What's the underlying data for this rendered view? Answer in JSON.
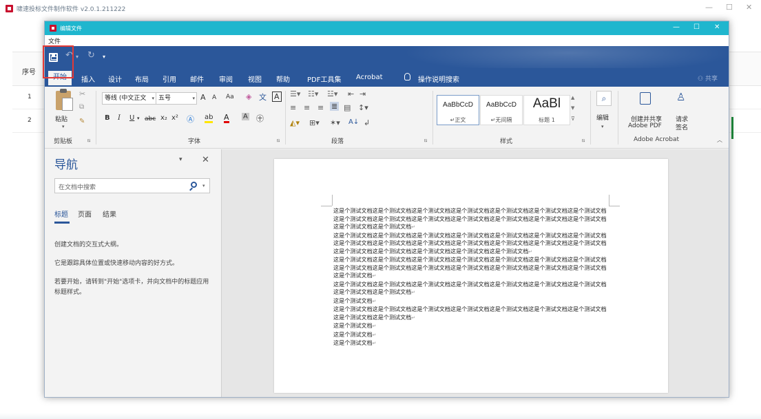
{
  "outer_app": {
    "title": "啸速投标文件制作软件 v2.0.1.211222",
    "table_header": "序号",
    "rows": [
      "1",
      "2"
    ]
  },
  "editor": {
    "title": "编辑文件",
    "menu_file": "文件"
  },
  "word": {
    "tabs": [
      "开始",
      "插入",
      "设计",
      "布局",
      "引用",
      "邮件",
      "审阅",
      "视图",
      "帮助",
      "PDF工具集",
      "Acrobat"
    ],
    "tell_me": "操作说明搜索",
    "share": "共享",
    "ribbon": {
      "clipboard": {
        "paste": "粘贴",
        "label": "剪贴板"
      },
      "font": {
        "name": "等线 (中文正文",
        "size": "五号",
        "label": "字体",
        "grow": "A",
        "shrink": "A",
        "case": "Aa"
      },
      "paragraph": {
        "label": "段落"
      },
      "styles": {
        "label": "样式",
        "items": [
          {
            "sample": "AaBbCcD",
            "name": "正文"
          },
          {
            "sample": "AaBbCcD",
            "name": "无间隔"
          },
          {
            "sample": "AaBl",
            "name": "标题 1"
          }
        ]
      },
      "editing": {
        "label": "编辑"
      },
      "acrobat": {
        "create": "创建并共享",
        "create2": "Adobe PDF",
        "request": "请求",
        "request2": "签名",
        "label": "Adobe Acrobat"
      }
    }
  },
  "nav": {
    "title": "导航",
    "search_placeholder": "在文档中搜索",
    "tabs": [
      "标题",
      "页面",
      "结果"
    ],
    "hint1": "创建文档的交互式大纲。",
    "hint2": "它是跟踪具体位置或快速移动内容的好方式。",
    "hint3": "若要开始，请转到\"开始\"选项卡，并向文档中的标题应用标题样式。"
  },
  "document": {
    "paragraphs": [
      "这是个测试文档这是个测试文档这是个测试文档这是个测试文档这是个测试文档这是个测试文档这是个测试文档这是个测试文档这是个测试文档这是个测试文档这是个测试文档这是个测试文档这是个测试文档这是个测试文档这是个测试文档这是个测试文档",
      "这是个测试文档这是个测试文档这是个测试文档这是个测试文档这是个测试文档这是个测试文档这是个测试文档这是个测试文档这是个测试文档这是个测试文档这是个测试文档这是个测试文档这是个测试文档这是个测试文档这是个测试文档这是个测试文档这是个测试文档这是个测试文档这是个测试文档",
      "这是个测试文档这是个测试文档这是个测试文档这是个测试文档这是个测试文档这是个测试文档这是个测试文档这是个测试文档这是个测试文档这是个测试文档这是个测试文档这是个测试文档这是个测试文档这是个测试文档这是个测试文档",
      "这是个测试文档这是个测试文档这是个测试文档这是个测试文档这是个测试文档这是个测试文档这是个测试文档这是个测试文档这是个测试文档",
      "这是个测试文档",
      "这是个测试文档这是个测试文档这是个测试文档这是个测试文档这是个测试文档这是个测试文档这是个测试文档这是个测试文档这是个测试文档",
      "这是个测试文档",
      "这是个测试文档",
      "这是个测试文档"
    ]
  },
  "colors": {
    "word_blue": "#2b579a",
    "editor_title": "#1fb6ce",
    "highlight": "#e53935"
  }
}
